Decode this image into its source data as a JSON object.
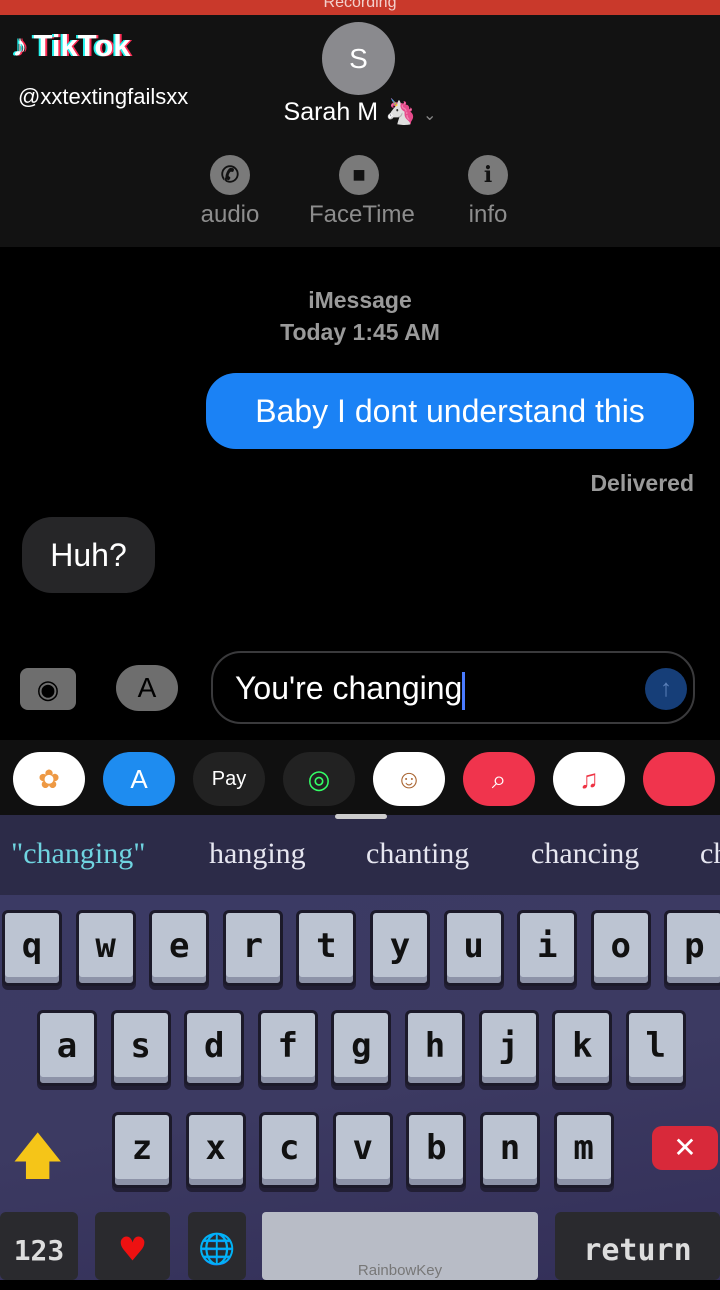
{
  "recording": {
    "label": "Recording",
    "color": "#c9392b"
  },
  "tiktok": {
    "logo": "TikTok",
    "user": "@xxtextingfailsxx"
  },
  "contact": {
    "initial": "S",
    "name": "Sarah M 🦄",
    "chevron": "⌄"
  },
  "actions": [
    {
      "label": "audio",
      "icon": "phone-icon",
      "glyph": "✆"
    },
    {
      "label": "FaceTime",
      "icon": "video-icon",
      "glyph": "■"
    },
    {
      "label": "info",
      "icon": "info-icon",
      "glyph": "i"
    }
  ],
  "thread": {
    "service": "iMessage",
    "time": "Today 1:45 AM"
  },
  "messages": [
    {
      "from": "me",
      "text": "Baby I dont understand this",
      "status": "Delivered"
    },
    {
      "from": "them",
      "text": "Huh?"
    }
  ],
  "compose": {
    "value": "You're changing",
    "send": "↑"
  },
  "apps": [
    {
      "name": "photos",
      "glyph": "✿"
    },
    {
      "name": "app-store",
      "glyph": "A"
    },
    {
      "name": "apple-pay",
      "glyph": "Pay"
    },
    {
      "name": "activity",
      "glyph": "◎"
    },
    {
      "name": "memoji",
      "glyph": "☺"
    },
    {
      "name": "search-images",
      "glyph": "⌕"
    },
    {
      "name": "music",
      "glyph": "♫"
    }
  ],
  "suggestions": [
    "\"changing\"",
    "hanging",
    "chanting",
    "chancing",
    "ch"
  ],
  "keyboard": {
    "row1": [
      "q",
      "w",
      "e",
      "r",
      "t",
      "y",
      "u",
      "i",
      "o",
      "p"
    ],
    "row2": [
      "a",
      "s",
      "d",
      "f",
      "g",
      "h",
      "j",
      "k",
      "l"
    ],
    "row3": [
      "z",
      "x",
      "c",
      "v",
      "b",
      "n",
      "m"
    ],
    "numbers": "123",
    "return": "return",
    "brand": "RainbowKey",
    "shift": "🡅",
    "delete": "✕",
    "heart": "♥",
    "globe": "🌐"
  }
}
